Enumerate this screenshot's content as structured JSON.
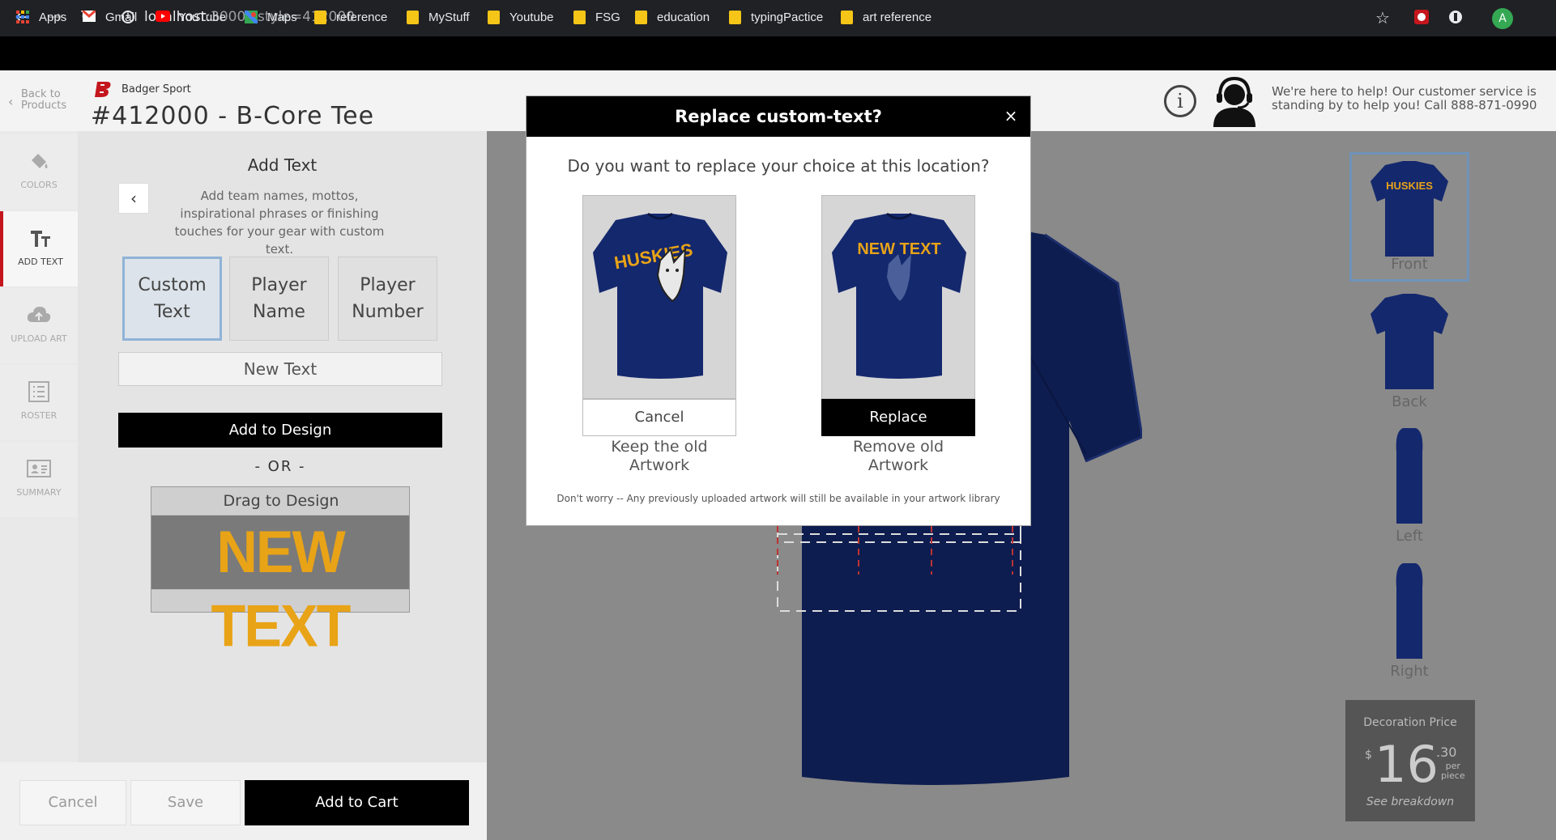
{
  "browser": {
    "url_host": "localhost",
    "url_rest": ":3000/?style=412000",
    "avatar_initial": "A",
    "bookmarks": [
      {
        "label": "Apps",
        "icon": "apps-grid-icon"
      },
      {
        "label": "Gmail",
        "icon": "gmail-icon"
      },
      {
        "label": "YouTube",
        "icon": "youtube-icon"
      },
      {
        "label": "Maps",
        "icon": "maps-icon"
      },
      {
        "label": "reference",
        "icon": "folder-icon"
      },
      {
        "label": "MyStuff",
        "icon": "folder-icon"
      },
      {
        "label": "Youtube",
        "icon": "folder-icon"
      },
      {
        "label": "FSG",
        "icon": "folder-icon"
      },
      {
        "label": "education",
        "icon": "folder-icon"
      },
      {
        "label": "typingPactice",
        "icon": "folder-icon"
      },
      {
        "label": "art reference",
        "icon": "folder-icon"
      }
    ]
  },
  "header": {
    "back_line1": "Back to",
    "back_line2": "Products",
    "brand": "Badger Sport",
    "product_title": "#412000 - B-Core Tee",
    "support_text": "We're here to help! Our customer service is standing by to help you! Call 888-871-0990"
  },
  "rail": {
    "items": [
      {
        "label": "COLORS",
        "icon": "paint-bucket-icon"
      },
      {
        "label": "ADD TEXT",
        "icon": "text-icon"
      },
      {
        "label": "UPLOAD ART",
        "icon": "cloud-upload-icon"
      },
      {
        "label": "ROSTER",
        "icon": "list-icon"
      },
      {
        "label": "SUMMARY",
        "icon": "id-card-icon"
      }
    ]
  },
  "panel": {
    "title": "Add Text",
    "description": "Add team names, mottos, inspirational phrases or finishing touches for your gear with custom text.",
    "types": [
      {
        "line1": "Custom",
        "line2": "Text"
      },
      {
        "line1": "Player",
        "line2": "Name"
      },
      {
        "line1": "Player",
        "line2": "Number"
      }
    ],
    "input_value": "New Text",
    "add_button": "Add to Design",
    "or": "- OR -",
    "drag_title": "Drag to Design",
    "drag_preview": "NEW TEXT"
  },
  "actions": {
    "cancel": "Cancel",
    "save": "Save",
    "add_to_cart": "Add to Cart"
  },
  "views": [
    {
      "label": "Front"
    },
    {
      "label": "Back"
    },
    {
      "label": "Left"
    },
    {
      "label": "Right"
    }
  ],
  "price": {
    "label": "Decoration Price",
    "dollar": "$",
    "whole": "16",
    "cents": ".30",
    "per1": "per",
    "per2": "piece",
    "link": "See breakdown"
  },
  "modal": {
    "title": "Replace custom-text?",
    "close": "×",
    "question": "Do you want to replace your choice at this location?",
    "left_art_text": "HUSKIES",
    "right_art_text": "NEW TEXT",
    "cancel": "Cancel",
    "replace": "Replace",
    "keep_line1": "Keep the old",
    "keep_line2": "Artwork",
    "remove_line1": "Remove old",
    "remove_line2": "Artwork",
    "note": "Don't worry -- Any previously uploaded artwork will still be available in your artwork library"
  },
  "colors": {
    "accent": "#c4161c",
    "shirt_navy": "#14286e",
    "text_gold": "#e8a317",
    "selected_blue": "#8fb3d6"
  }
}
